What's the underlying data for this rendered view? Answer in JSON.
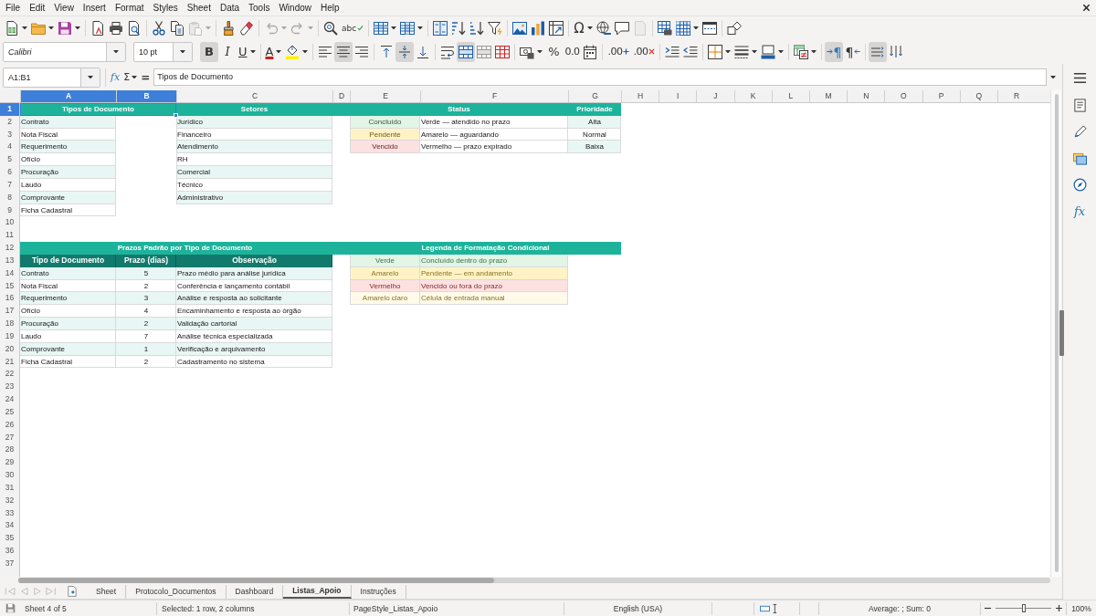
{
  "menu_bar": {
    "items": [
      "File",
      "Edit",
      "View",
      "Insert",
      "Format",
      "Styles",
      "Sheet",
      "Data",
      "Tools",
      "Window",
      "Help"
    ]
  },
  "standard_toolbar": {
    "groups": [
      [
        {
          "kind": "new",
          "disabled": false
        },
        {
          "kind": "open",
          "disabled": false
        },
        {
          "kind": "save",
          "disabled": false
        }
      ],
      [
        {
          "kind": "export_pdf",
          "disabled": false
        },
        {
          "kind": "print",
          "disabled": false
        },
        {
          "kind": "print_preview",
          "disabled": false
        }
      ],
      [
        {
          "kind": "cut",
          "disabled": false
        },
        {
          "kind": "copy",
          "disabled": false
        },
        {
          "kind": "paste",
          "disabled": true
        }
      ],
      [
        {
          "kind": "clone",
          "disabled": false
        },
        {
          "kind": "clear",
          "disabled": false
        }
      ],
      [
        {
          "kind": "undo",
          "disabled": true
        },
        {
          "kind": "redo",
          "disabled": true
        }
      ],
      [
        {
          "kind": "find",
          "disabled": false
        },
        {
          "kind": "spelling",
          "label": "abc",
          "disabled": false
        }
      ],
      [
        {
          "kind": "rows",
          "disabled": false
        },
        {
          "kind": "columns",
          "disabled": false
        }
      ],
      [
        {
          "kind": "sort",
          "disabled": false
        },
        {
          "kind": "sort_ascending",
          "disabled": false
        },
        {
          "kind": "sort_descending",
          "disabled": false
        },
        {
          "kind": "autofilter",
          "disabled": false
        }
      ],
      [
        {
          "kind": "image",
          "disabled": false
        },
        {
          "kind": "chart",
          "disabled": false
        },
        {
          "kind": "pivot",
          "disabled": false
        }
      ],
      [
        {
          "kind": "special_character",
          "label": "Ω",
          "disabled": false
        },
        {
          "kind": "hyperlink",
          "disabled": false
        },
        {
          "kind": "comment",
          "disabled": false
        },
        {
          "kind": "header_footer",
          "disabled": true
        }
      ],
      [
        {
          "kind": "print_area",
          "disabled": false
        },
        {
          "kind": "freeze",
          "disabled": false
        },
        {
          "kind": "split",
          "disabled": false
        }
      ],
      [
        {
          "kind": "shapes",
          "disabled": false
        }
      ]
    ]
  },
  "formatting_toolbar": {
    "font_name": "Calibri",
    "font_size": "10 pt",
    "groups": [
      [
        {
          "kind": "bold",
          "label": "B",
          "on": true
        },
        {
          "kind": "italic",
          "label": "I",
          "on": false
        },
        {
          "kind": "underline",
          "label": "U",
          "on": false
        }
      ],
      [
        {
          "kind": "font_color",
          "label": "A",
          "on": false
        },
        {
          "kind": "highlight",
          "on": false
        }
      ],
      [
        {
          "kind": "align_left",
          "on": false
        },
        {
          "kind": "align_center",
          "on": true
        },
        {
          "kind": "align_right",
          "on": false
        }
      ],
      [
        {
          "kind": "align_top",
          "on": false
        },
        {
          "kind": "align_middle",
          "on": true
        },
        {
          "kind": "align_bottom",
          "on": false
        }
      ],
      [
        {
          "kind": "wrap",
          "on": false
        },
        {
          "kind": "merge_center",
          "on": true
        },
        {
          "kind": "merge",
          "on": false
        },
        {
          "kind": "unmerge",
          "on": false
        }
      ],
      [
        {
          "kind": "currency",
          "on": false
        },
        {
          "kind": "percent",
          "label": "%",
          "on": false
        },
        {
          "kind": "number",
          "label": "0.0",
          "on": false
        },
        {
          "kind": "date",
          "on": false
        }
      ],
      [
        {
          "kind": "add_decimal",
          "label": ".00",
          "on": false
        },
        {
          "kind": "delete_decimal",
          "label": ".00",
          "on": false
        }
      ],
      [
        {
          "kind": "indent_more",
          "on": false
        },
        {
          "kind": "indent_less",
          "on": false
        }
      ],
      [
        {
          "kind": "borders",
          "on": false
        },
        {
          "kind": "border_style",
          "on": false
        },
        {
          "kind": "border_color",
          "on": false
        }
      ],
      [
        {
          "kind": "conditional",
          "on": false
        }
      ],
      [
        {
          "kind": "ltr",
          "label": "¶",
          "on": true
        },
        {
          "kind": "rtl",
          "label": "¶",
          "on": false
        }
      ],
      [
        {
          "kind": "text_lr",
          "on": true
        },
        {
          "kind": "text_tb",
          "on": false
        }
      ]
    ]
  },
  "formula_bar": {
    "name_box": "A1:B1",
    "function_wizard": "fx",
    "sum": "Σ",
    "formula": "=",
    "value": "Tipos de Documento"
  },
  "sheet": {
    "columns": [
      {
        "label": "A",
        "selected": true
      },
      {
        "label": "B",
        "selected": true
      },
      {
        "label": "C",
        "selected": false
      },
      {
        "label": "D",
        "selected": false
      },
      {
        "label": "E",
        "selected": false
      },
      {
        "label": "F",
        "selected": false
      },
      {
        "label": "G",
        "selected": false
      },
      {
        "label": "H",
        "selected": false
      },
      {
        "label": "I",
        "selected": false
      },
      {
        "label": "J",
        "selected": false
      },
      {
        "label": "K",
        "selected": false
      },
      {
        "label": "L",
        "selected": false
      },
      {
        "label": "M",
        "selected": false
      },
      {
        "label": "N",
        "selected": false
      },
      {
        "label": "O",
        "selected": false
      },
      {
        "label": "P",
        "selected": false
      },
      {
        "label": "Q",
        "selected": false
      },
      {
        "label": "R",
        "selected": false
      }
    ],
    "rows": [
      {
        "label": "1",
        "selected": true
      },
      {
        "label": "2",
        "selected": false
      },
      {
        "label": "3",
        "selected": false
      },
      {
        "label": "4",
        "selected": false
      },
      {
        "label": "5",
        "selected": false
      },
      {
        "label": "6",
        "selected": false
      },
      {
        "label": "7",
        "selected": false
      },
      {
        "label": "8",
        "selected": false
      },
      {
        "label": "9",
        "selected": false
      },
      {
        "label": "10",
        "selected": false
      },
      {
        "label": "11",
        "selected": false
      },
      {
        "label": "12",
        "selected": false
      },
      {
        "label": "13",
        "selected": false
      },
      {
        "label": "14",
        "selected": false
      },
      {
        "label": "15",
        "selected": false
      },
      {
        "label": "16",
        "selected": false
      },
      {
        "label": "17",
        "selected": false
      },
      {
        "label": "18",
        "selected": false
      },
      {
        "label": "19",
        "selected": false
      },
      {
        "label": "20",
        "selected": false
      },
      {
        "label": "21",
        "selected": false
      },
      {
        "label": "22",
        "selected": false
      },
      {
        "label": "23",
        "selected": false
      },
      {
        "label": "24",
        "selected": false
      },
      {
        "label": "25",
        "selected": false
      },
      {
        "label": "26",
        "selected": false
      },
      {
        "label": "27",
        "selected": false
      },
      {
        "label": "28",
        "selected": false
      },
      {
        "label": "29",
        "selected": false
      },
      {
        "label": "30",
        "selected": false
      },
      {
        "label": "31",
        "selected": false
      },
      {
        "label": "32",
        "selected": false
      },
      {
        "label": "33",
        "selected": false
      },
      {
        "label": "34",
        "selected": false
      },
      {
        "label": "35",
        "selected": false
      },
      {
        "label": "36",
        "selected": false
      },
      {
        "label": "37",
        "selected": false
      }
    ],
    "document_types": {
      "title": "Tipos de Documento",
      "items": [
        "Contrato",
        "Nota Fiscal",
        "Requerimento",
        "Ofício",
        "Procuração",
        "Laudo",
        "Comprovante",
        "Ficha Cadastral"
      ]
    },
    "sectors": {
      "title": "Setores",
      "items": [
        "Jurídico",
        "Financeiro",
        "Atendimento",
        "RH",
        "Comercial",
        "Técnico",
        "Administrativo"
      ]
    },
    "status_table": {
      "title": "Status",
      "priority_title": "Prioridade",
      "rows": [
        {
          "name": "Concluído",
          "description": "Verde — atendido no prazo",
          "priority": "Alta",
          "color": "#e2f5e6"
        },
        {
          "name": "Pendente",
          "description": "Amarelo — aguardando",
          "priority": "Normal",
          "color": "#fff3c6"
        },
        {
          "name": "Vencido",
          "description": "Vermelho — prazo expirado",
          "priority": "Baixa",
          "color": "#fde1e1"
        }
      ]
    },
    "deadlines": {
      "title": "Prazos Padrão por Tipo de Documento",
      "headers": [
        "Tipo de Documento",
        "Prazo (dias)",
        "Observação"
      ],
      "rows": [
        {
          "type": "Contrato",
          "days": "5",
          "note": "Prazo médio para análise jurídica"
        },
        {
          "type": "Nota Fiscal",
          "days": "2",
          "note": "Conferência e lançamento contábil"
        },
        {
          "type": "Requerimento",
          "days": "3",
          "note": "Análise e resposta ao solicitante"
        },
        {
          "type": "Ofício",
          "days": "4",
          "note": "Encaminhamento e resposta ao órgão"
        },
        {
          "type": "Procuração",
          "days": "2",
          "note": "Validação cartorial"
        },
        {
          "type": "Laudo",
          "days": "7",
          "note": "Análise técnica especializada"
        },
        {
          "type": "Comprovante",
          "days": "1",
          "note": "Verificação e arquivamento"
        },
        {
          "type": "Ficha Cadastral",
          "days": "2",
          "note": "Cadastramento no sistema"
        }
      ]
    },
    "legend": {
      "title": "Legenda de Formatação Condicional",
      "rows": [
        {
          "name": "Verde",
          "description": "Concluído dentro do prazo",
          "color": "#e2f5e6"
        },
        {
          "name": "Amarelo",
          "description": "Pendente — em andamento",
          "color": "#fff3c6"
        },
        {
          "name": "Vermelho",
          "description": "Vencido ou fora do prazo",
          "color": "#fde1e1"
        },
        {
          "name": "Amarelo claro",
          "description": "Célula de entrada manual",
          "color": "#fffae9"
        }
      ]
    }
  },
  "sidebar": {
    "buttons": [
      {
        "kind": "menu"
      },
      {
        "kind": "properties"
      },
      {
        "kind": "styles"
      },
      {
        "kind": "gallery"
      },
      {
        "kind": "navigator"
      },
      {
        "kind": "functions",
        "label": "fx"
      }
    ]
  },
  "sheet_navigation": {
    "disabled": true
  },
  "sheet_tabs": [
    {
      "label": "Sheet",
      "selected": false
    },
    {
      "label": "Protocolo_Documentos",
      "selected": false
    },
    {
      "label": "Dashboard",
      "selected": false
    },
    {
      "label": "Listas_Apoio",
      "selected": true
    },
    {
      "label": "Instruções",
      "selected": false
    }
  ],
  "status_bar": {
    "sheet_position": "Sheet 4 of 5",
    "selection": "Selected: 1 row, 2 columns",
    "page_style": "PageStyle_Listas_Apoio",
    "language": "English (USA)",
    "summary": "Average: ; Sum: 0",
    "zoom_slider": {
      "level": 0.5
    },
    "zoom": "100%"
  }
}
